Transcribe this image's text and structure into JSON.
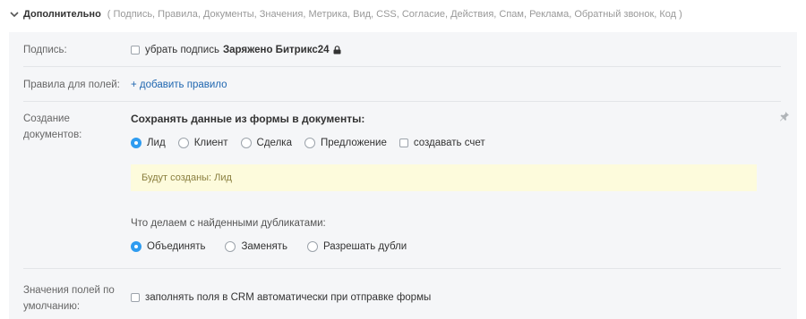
{
  "header": {
    "title": "Дополнительно",
    "sections": "( Подпись, Правила, Документы, Значения, Метрика, Вид, CSS, Согласие, Действия, Спам, Реклама, Обратный звонок, Код )"
  },
  "signature": {
    "label": "Подпись:",
    "checkbox_label": "убрать подпись",
    "brand": "Заряжено Битрикс24",
    "checked": false
  },
  "rules": {
    "label": "Правила для полей:",
    "add_link": "+ добавить правило"
  },
  "documents": {
    "label_line1": "Создание",
    "label_line2": "документов:",
    "heading": "Сохранять данные из формы в документы:",
    "options": [
      "Лид",
      "Клиент",
      "Сделка",
      "Предложение"
    ],
    "selected": "Лид",
    "invoice_checkbox": "создавать счет",
    "note": "Будут созданы: Лид",
    "duplicates_label": "Что делаем с найденными дубликатами:",
    "duplicates_options": [
      "Объединять",
      "Заменять",
      "Разрешать дубли"
    ],
    "duplicates_selected": "Объединять"
  },
  "defaults": {
    "label_line1": "Значения полей по",
    "label_line2": "умолчанию:",
    "checkbox_label": "заполнять поля в CRM автоматически при отправке формы"
  },
  "colors": {
    "accent": "#2f9cf0",
    "link": "#2067b0",
    "note_bg": "#fdfbdc",
    "panel_bg": "#f5f6f8"
  }
}
